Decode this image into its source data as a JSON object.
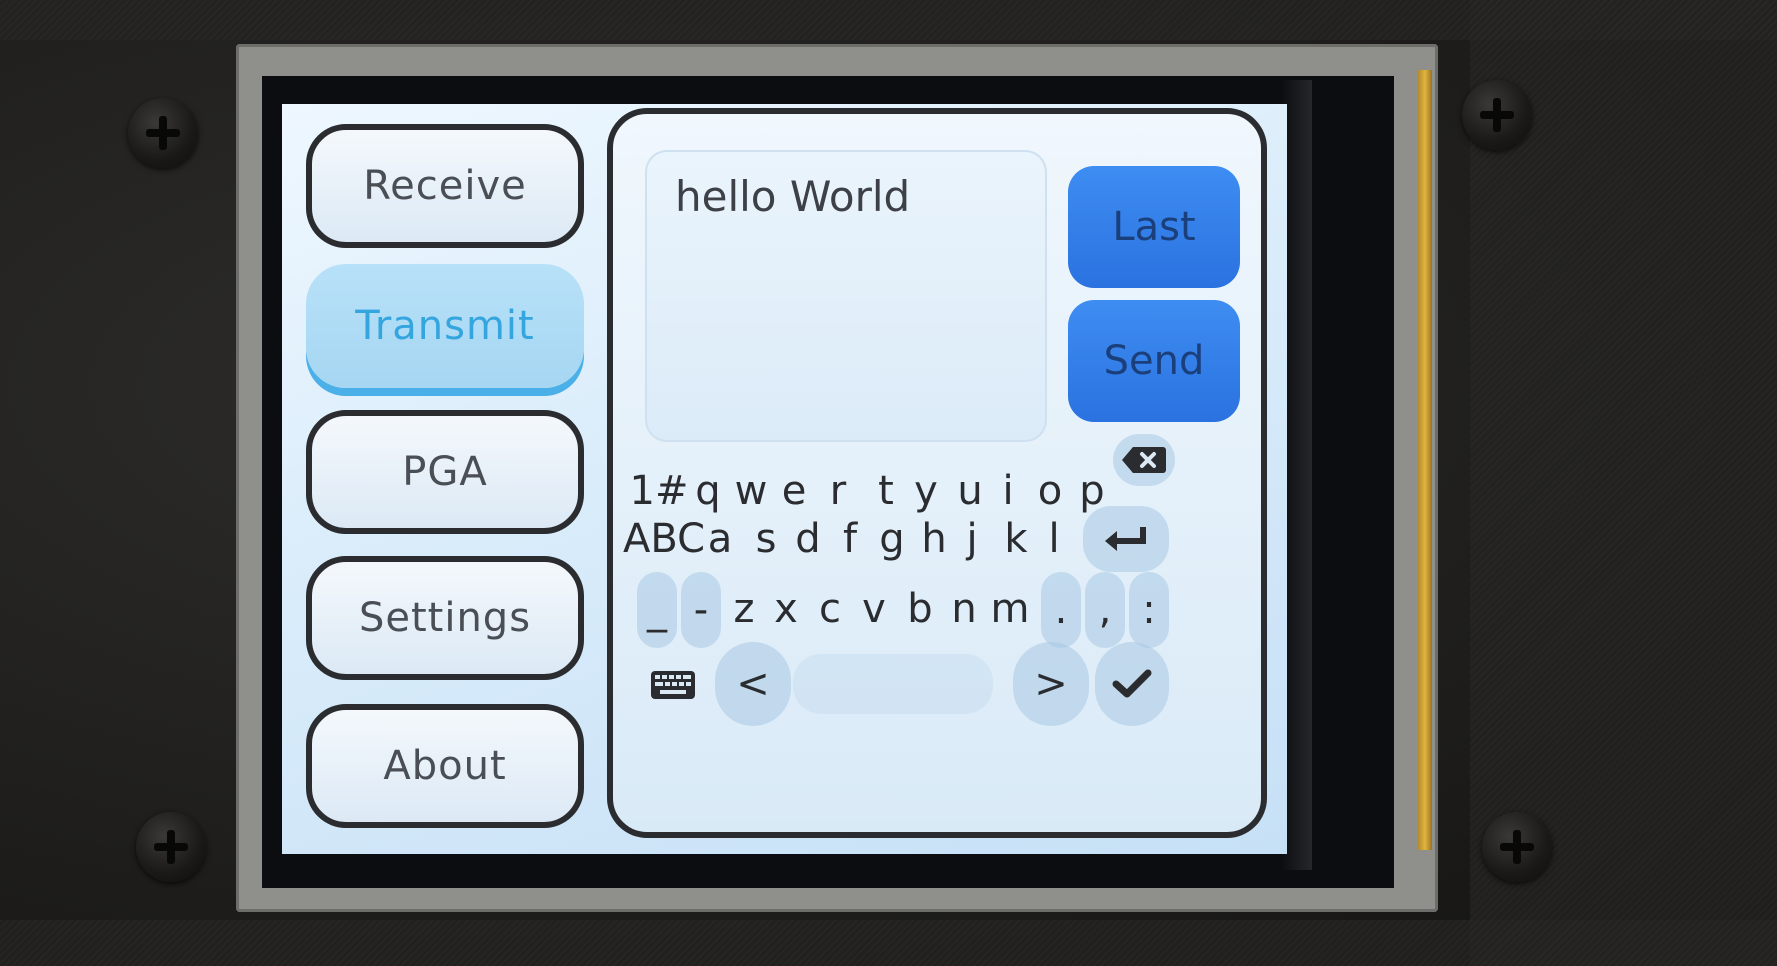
{
  "nav": {
    "items": [
      {
        "label": "Receive",
        "active": false
      },
      {
        "label": "Transmit",
        "active": true
      },
      {
        "label": "PGA",
        "active": false
      },
      {
        "label": "Settings",
        "active": false
      },
      {
        "label": "About",
        "active": false
      }
    ]
  },
  "transmit": {
    "text_value": "hello World",
    "last_label": "Last",
    "send_label": "Send"
  },
  "keyboard": {
    "row1": {
      "mode": "1#",
      "keys": [
        "q",
        "w",
        "e",
        "r",
        "t",
        "y",
        "u",
        "i",
        "o",
        "p"
      ],
      "backspace_icon": "backspace-icon"
    },
    "row2": {
      "mode": "ABC",
      "keys": [
        "a",
        "s",
        "d",
        "f",
        "g",
        "h",
        "j",
        "k",
        "l"
      ],
      "enter_icon": "enter-icon"
    },
    "row3": {
      "keys": [
        "_",
        "-",
        "z",
        "x",
        "c",
        "v",
        "b",
        "n",
        "m",
        ".",
        ",",
        ":"
      ]
    },
    "row4": {
      "keyboard_icon": "keyboard-icon",
      "left": "<",
      "right": ">",
      "ok_icon": "checkmark-icon"
    }
  },
  "colors": {
    "accent_blue": "#2a72e0",
    "active_tab": "#35a5df",
    "screen_bg": "#d9ecfa"
  }
}
